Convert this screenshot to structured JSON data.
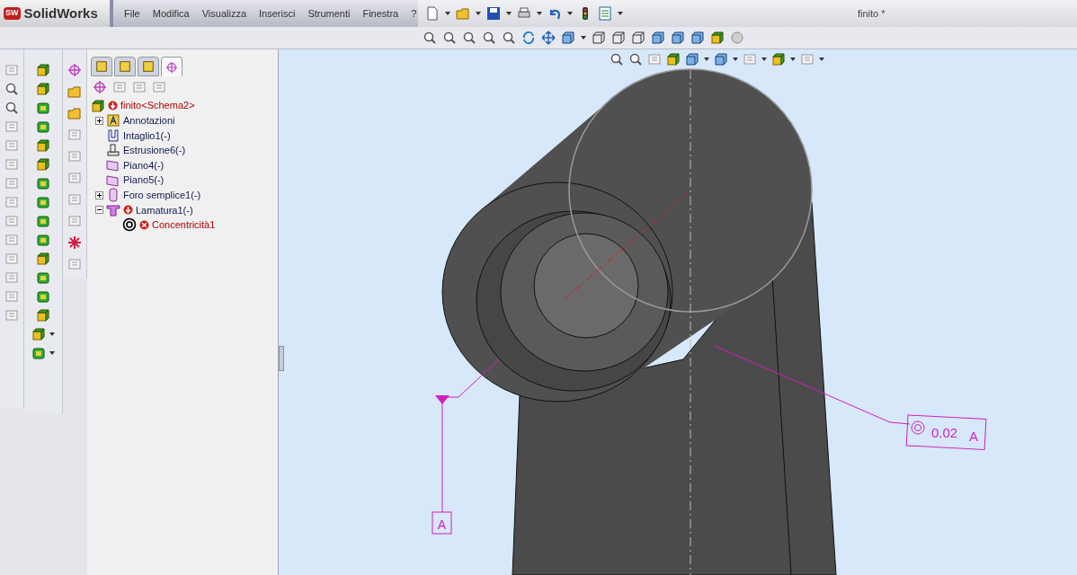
{
  "app": {
    "logo_badge": "SW",
    "logo_text": "SolidWorks",
    "title": "finito *"
  },
  "menu": [
    "File",
    "Modifica",
    "Visualizza",
    "Inserisci",
    "Strumenti",
    "Finestra",
    "?"
  ],
  "panel_tabs": [
    {
      "selected": false
    },
    {
      "selected": false
    },
    {
      "selected": false
    },
    {
      "selected": true
    }
  ],
  "tree": {
    "label": "finito<Schema2>",
    "rebuild_error": true,
    "mate_error": false,
    "failed": true,
    "children": [
      {
        "label": "Annotazioni",
        "kind": "annotation",
        "expanded": false,
        "rebuild_error": false,
        "mate_error": false,
        "failed": false
      },
      {
        "label": "Intaglio1(-)",
        "kind": "cut",
        "rebuild_error": false,
        "mate_error": false,
        "failed": false
      },
      {
        "label": "Estrusione6(-)",
        "kind": "extrude",
        "rebuild_error": false,
        "mate_error": false,
        "failed": false
      },
      {
        "label": "Piano4(-)",
        "kind": "plane",
        "rebuild_error": false,
        "mate_error": false,
        "failed": false
      },
      {
        "label": "Piano5(-)",
        "kind": "plane",
        "rebuild_error": false,
        "mate_error": false,
        "failed": false
      },
      {
        "label": "Foro semplice1(-)",
        "kind": "hole",
        "expanded": false,
        "rebuild_error": false,
        "mate_error": false,
        "failed": false
      },
      {
        "label": "Lamatura1(-)",
        "kind": "counterbore",
        "rebuild_error": true,
        "mate_error": false,
        "expanded": true,
        "failed": false,
        "children": [
          {
            "label": "Concentricità1",
            "kind": "concentric",
            "rebuild_error": false,
            "mate_error": true,
            "failed": true
          }
        ]
      }
    ]
  },
  "viewport": {
    "datum_label": "A",
    "tolerance": {
      "value": "0.02",
      "datum": "A"
    }
  }
}
